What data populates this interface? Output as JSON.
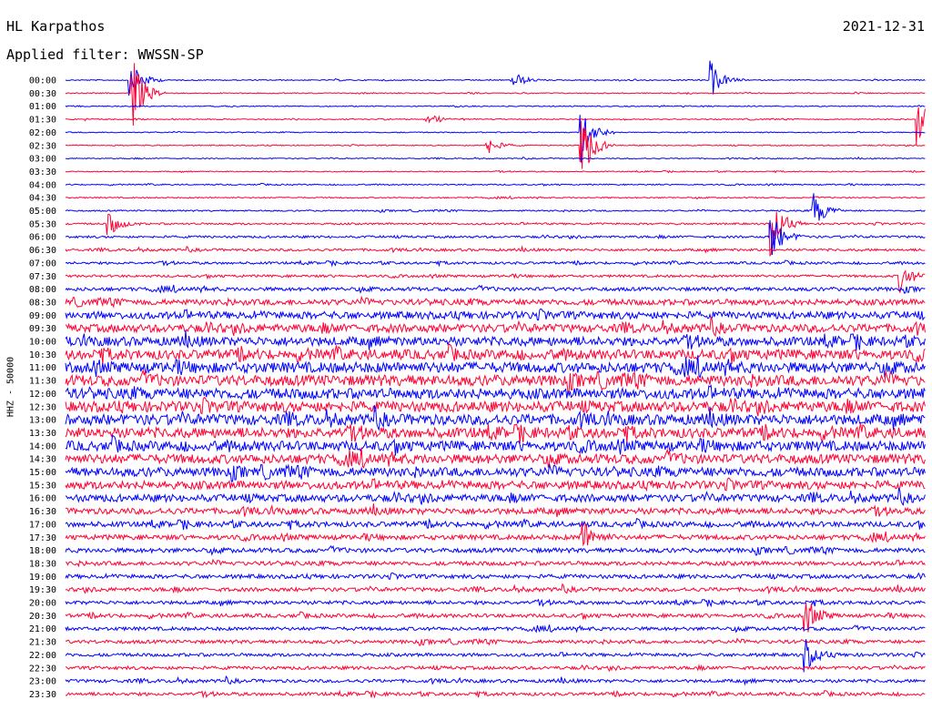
{
  "header": {
    "station": "HL Karpathos",
    "date": "2021-12-31",
    "filter_text": "Applied filter: WWSSN-SP"
  },
  "chart_data": {
    "type": "line",
    "title": "HL Karpathos",
    "ylabel": "HHZ - 50000",
    "rows": [
      "00:00",
      "00:30",
      "01:00",
      "01:30",
      "02:00",
      "02:30",
      "03:00",
      "03:30",
      "04:00",
      "04:30",
      "05:00",
      "05:30",
      "06:00",
      "06:30",
      "07:00",
      "07:30",
      "08:00",
      "08:30",
      "09:00",
      "09:30",
      "10:00",
      "10:30",
      "11:00",
      "11:30",
      "12:00",
      "12:30",
      "13:00",
      "13:30",
      "14:00",
      "14:30",
      "15:00",
      "15:30",
      "16:00",
      "16:30",
      "17:00",
      "17:30",
      "18:00",
      "18:30",
      "19:00",
      "19:30",
      "20:00",
      "20:30",
      "21:00",
      "21:30",
      "22:00",
      "22:30",
      "23:00",
      "23:30"
    ],
    "series_colors": [
      "#0000ff",
      "#ff0033"
    ],
    "noise_level_per_row": [
      0.25,
      0.25,
      0.25,
      0.25,
      0.25,
      0.25,
      0.25,
      0.25,
      0.3,
      0.3,
      0.35,
      0.45,
      0.55,
      0.6,
      0.6,
      0.6,
      0.9,
      1.4,
      1.8,
      2.0,
      2.2,
      2.4,
      2.6,
      2.6,
      2.6,
      2.6,
      2.6,
      2.5,
      2.4,
      2.3,
      2.2,
      2.0,
      1.8,
      1.5,
      1.3,
      1.2,
      1.1,
      1.0,
      1.0,
      0.95,
      0.9,
      0.9,
      0.85,
      0.85,
      0.8,
      0.8,
      0.8,
      0.8
    ],
    "events": [
      {
        "row": 0,
        "x": 0.075,
        "amp": 4
      },
      {
        "row": 0,
        "x": 0.75,
        "amp": 3
      },
      {
        "row": 0,
        "x": 0.52,
        "amp": 1.5
      },
      {
        "row": 1,
        "x": 0.078,
        "amp": 6
      },
      {
        "row": 3,
        "x": 0.99,
        "amp": 4
      },
      {
        "row": 3,
        "x": 0.42,
        "amp": 1.2
      },
      {
        "row": 4,
        "x": 0.6,
        "amp": 5
      },
      {
        "row": 5,
        "x": 0.6,
        "amp": 6
      },
      {
        "row": 5,
        "x": 0.49,
        "amp": 1.5
      },
      {
        "row": 10,
        "x": 0.87,
        "amp": 3
      },
      {
        "row": 11,
        "x": 0.82,
        "amp": 5
      },
      {
        "row": 12,
        "x": 0.82,
        "amp": 4
      },
      {
        "row": 11,
        "x": 0.05,
        "amp": 2
      },
      {
        "row": 15,
        "x": 0.97,
        "amp": 2.5
      },
      {
        "row": 35,
        "x": 0.6,
        "amp": 3
      },
      {
        "row": 41,
        "x": 0.86,
        "amp": 3
      },
      {
        "row": 44,
        "x": 0.86,
        "amp": 2.5
      }
    ]
  }
}
